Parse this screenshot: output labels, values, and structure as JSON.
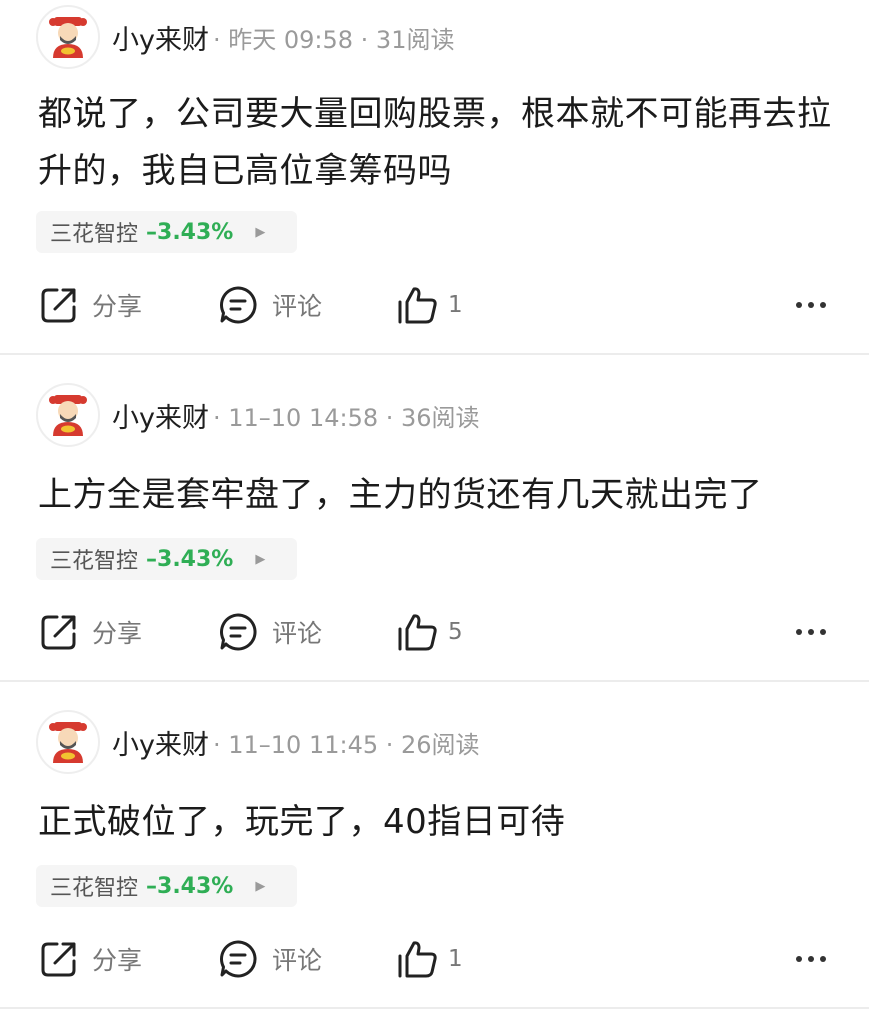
{
  "posts": [
    {
      "username": "小y来财",
      "meta": "· 昨天 09:58 · 31阅读",
      "content": "都说了，公司要大量回购股票，根本就不可能再去拉升的，我自已高位拿筹码吗",
      "stock": {
        "name": "三花智控",
        "change": "–3.43%",
        "arrow": "▶"
      },
      "actions": {
        "share": "分享",
        "comment": "评论",
        "likes": "1"
      }
    },
    {
      "username": "小y来财",
      "meta": "· 11–10 14:58 · 36阅读",
      "content": "上方全是套牢盘了，主力的货还有几天就出完了",
      "stock": {
        "name": "三花智控",
        "change": "–3.43%",
        "arrow": "▶"
      },
      "actions": {
        "share": "分享",
        "comment": "评论",
        "likes": "5"
      }
    },
    {
      "username": "小y来财",
      "meta": "· 11–10 11:45 · 26阅读",
      "content": "正式破位了，玩完了，40指日可待",
      "stock": {
        "name": "三花智控",
        "change": "–3.43%",
        "arrow": "▶"
      },
      "actions": {
        "share": "分享",
        "comment": "评论",
        "likes": "1"
      }
    }
  ],
  "icons": {
    "avatar": "caishen-avatar-icon",
    "share": "share-icon",
    "comment": "comment-icon",
    "like": "thumbs-up-icon",
    "more": "more-dots-icon"
  },
  "colors": {
    "negative_change": "#2fae55",
    "meta_gray": "#9a9a9a",
    "divider": "#ececec"
  }
}
